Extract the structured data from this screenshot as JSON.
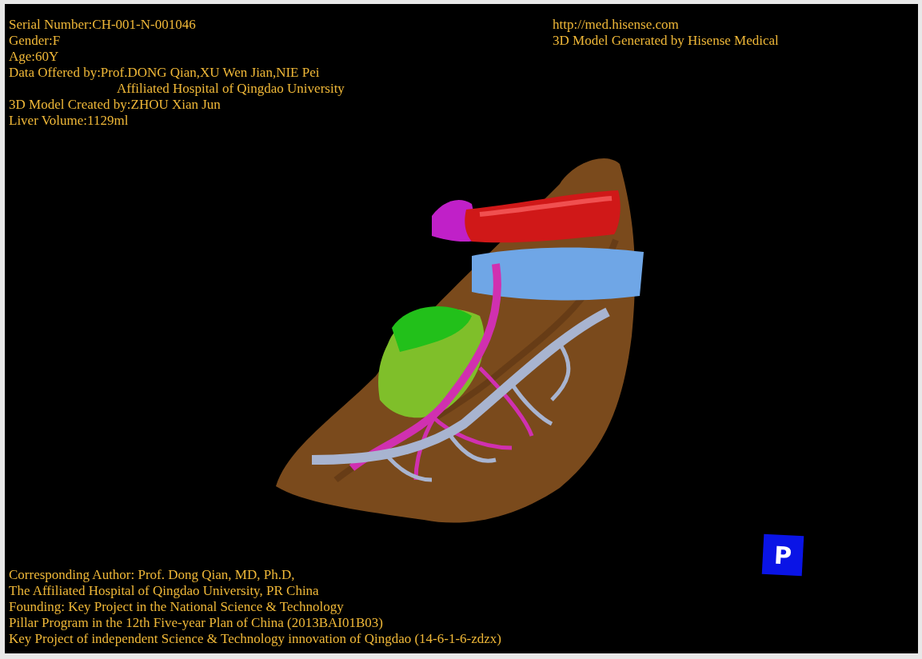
{
  "patient_info": [
    {
      "text": "Serial Number:CH-001-N-001046"
    },
    {
      "text": "Gender:F"
    },
    {
      "text": "Age:60Y"
    },
    {
      "text": "Data Offered by:Prof.DONG Qian,XU Wen Jian,NIE Pei",
      "continuation": "Affiliated Hospital of Qingdao University"
    },
    {
      "text": "3D Model Created by:ZHOU Xian Jun"
    },
    {
      "text": "Liver Volume:1129ml"
    }
  ],
  "website": "http://med.hisense.com",
  "generator": "3D Model Generated by Hisense Medical",
  "credits": [
    "Corresponding Author: Prof. Dong Qian, MD, Ph.D,",
    "The Affiliated Hospital of Qingdao University, PR China",
    "Founding: Key Project in the National Science & Technology",
    "Pillar Program in the 12th Five-year Plan of China (2013BAI01B03)",
    "Key Project of independent Science & Technology innovation of Qingdao (14-6-1-6-zdzx)"
  ],
  "orientation_cube": {
    "label": "P"
  }
}
